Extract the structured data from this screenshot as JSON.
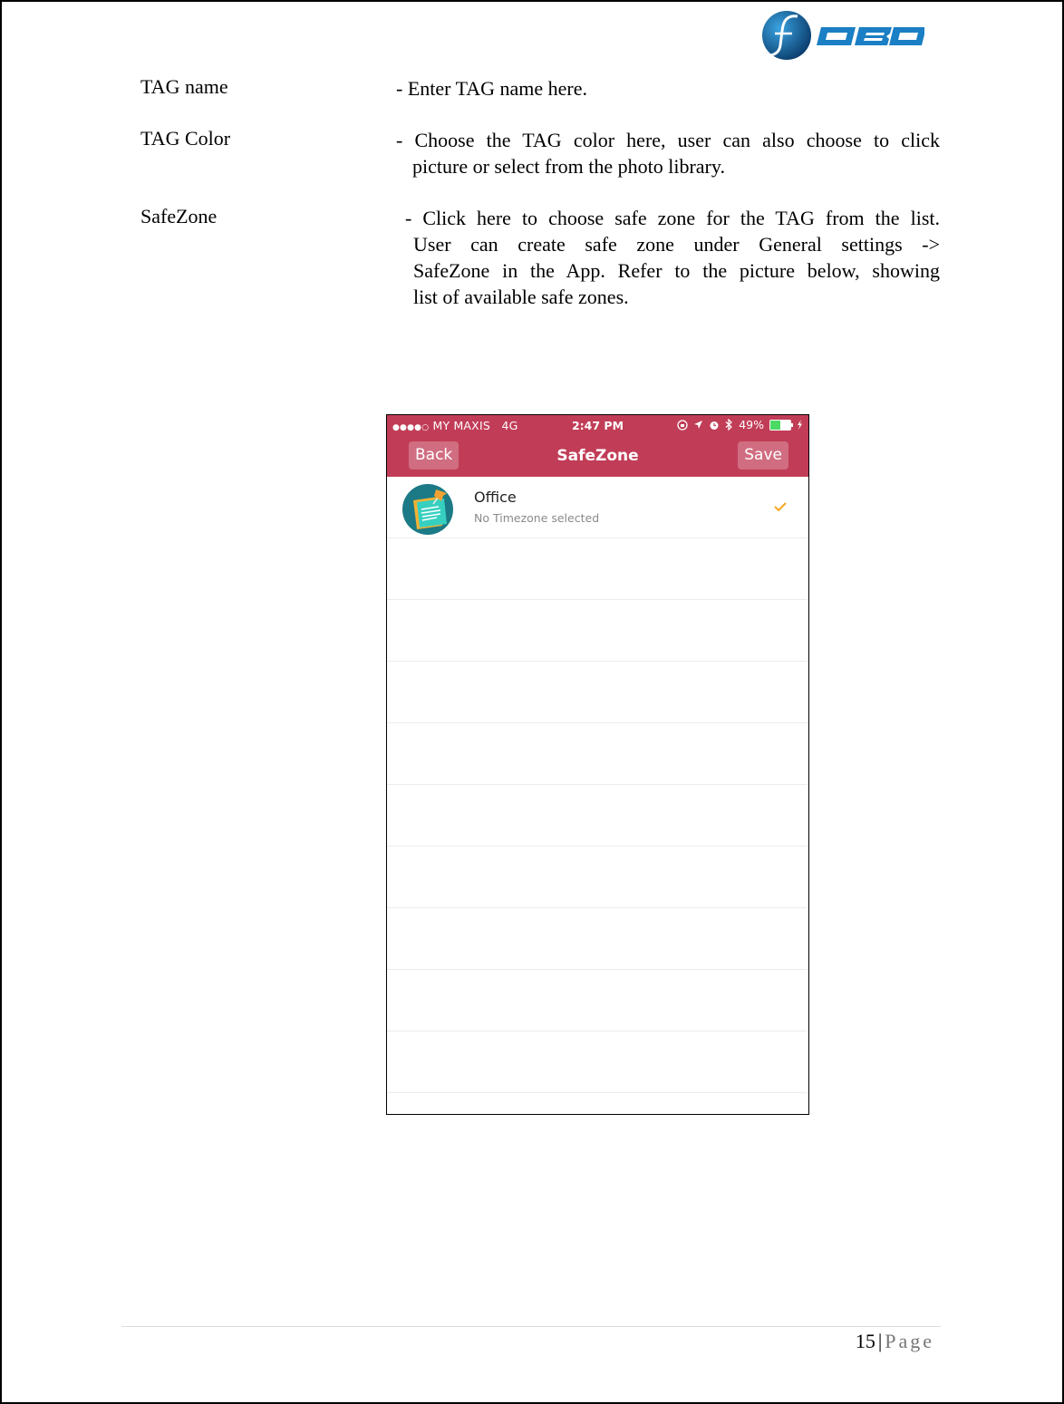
{
  "logo": {
    "text": "OBO",
    "mark": "f",
    "icon": "fobo-logo",
    "colors": {
      "blue": "#1a7fc4",
      "dark": "#0b3e6e"
    }
  },
  "definitions": [
    {
      "term": "TAG name",
      "lines": [
        "- Enter TAG name here."
      ]
    },
    {
      "term": "TAG Color",
      "lines": [
        "- Choose the TAG color here, user can also choose to click",
        "picture or select from the photo library."
      ]
    },
    {
      "term": "SafeZone",
      "lines": [
        "- Click here to choose safe zone for the TAG from the list.",
        "User can create safe zone under General settings ->",
        "SafeZone in the App. Refer to the picture below, showing",
        "list of available safe zones."
      ]
    }
  ],
  "phone": {
    "status_bar": {
      "signal": "●●●●○",
      "carrier": "MY MAXIS",
      "network": "4G",
      "time": "2:47 PM",
      "icons": [
        "rotation-lock-icon",
        "location-arrow-icon",
        "alarm-icon",
        "bluetooth-icon"
      ],
      "battery_text": "49%",
      "battery_level": 0.49,
      "charging_icon": "lightning-icon"
    },
    "nav": {
      "back_label": "Back",
      "title": "SafeZone",
      "save_label": "Save"
    },
    "accent_color": "#c13d57",
    "zones": [
      {
        "name": "Office",
        "subtitle": "No Timezone selected",
        "selected": true,
        "icon": "sticky-note-icon"
      }
    ],
    "empty_rows": 9,
    "check_color": "#f5a623"
  },
  "footer": {
    "page_number": "15",
    "separator": "|",
    "page_label": "Page"
  }
}
